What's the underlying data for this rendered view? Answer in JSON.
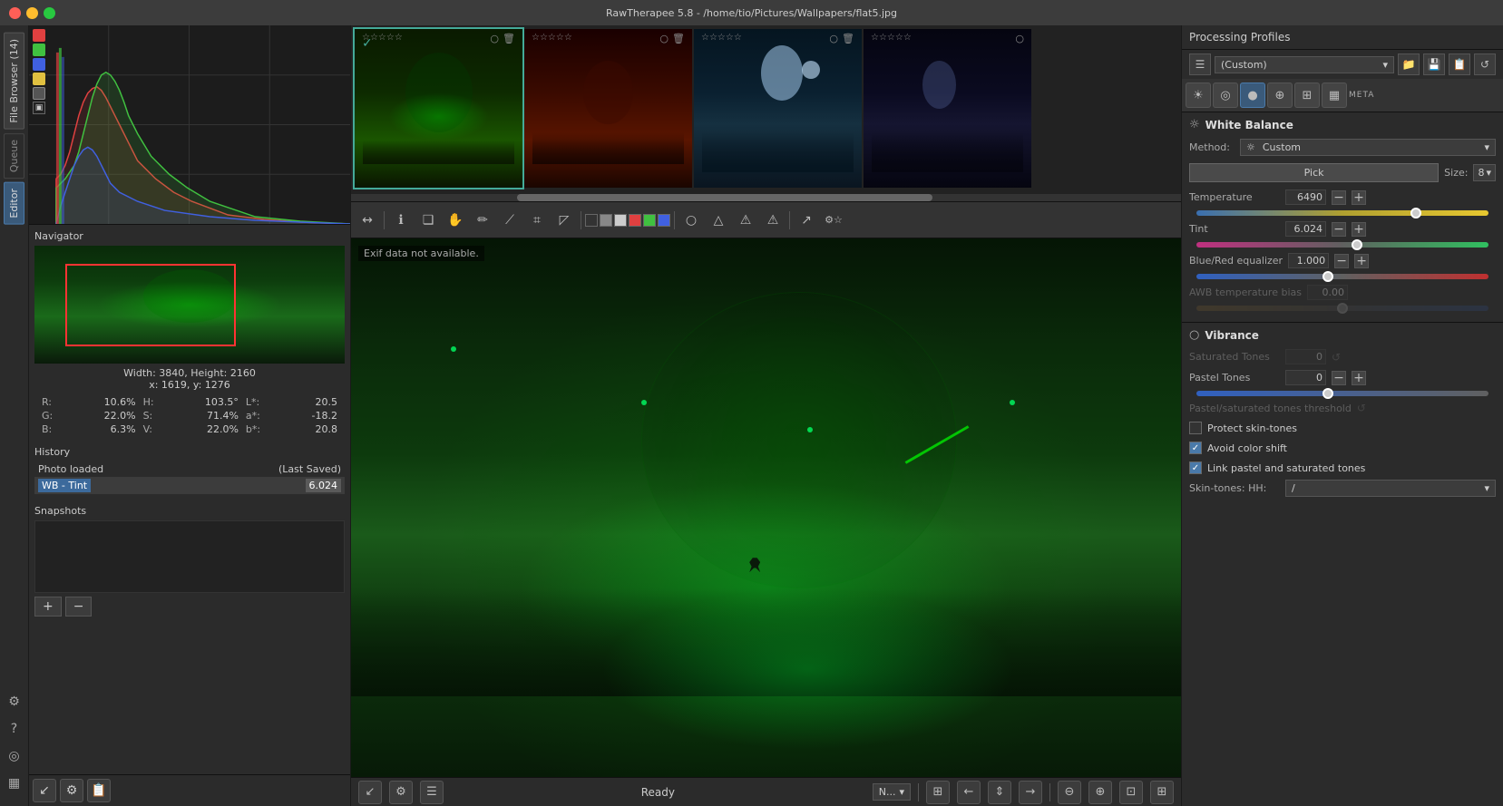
{
  "titlebar": {
    "title": "RawTherapee 5.8 - /home/tio/Pictures/Wallpapers/flat5.jpg"
  },
  "left_sidebar": {
    "tabs": [
      {
        "name": "file-browser",
        "label": "File Browser (14)",
        "active": false
      },
      {
        "name": "queue",
        "label": "Queue",
        "active": false
      },
      {
        "name": "editor",
        "label": "Editor",
        "active": true
      }
    ],
    "bottom_icons": [
      "settings",
      "help",
      "info",
      "chart"
    ]
  },
  "navigator": {
    "title": "Navigator",
    "dimensions": "Width: 3840, Height: 2160",
    "coords": "x: 1619, y: 1276",
    "color_info": {
      "R_label": "R:",
      "R_val": "10.6%",
      "H_label": "H:",
      "H_val": "103.5°",
      "L_label": "L*:",
      "L_val": "20.5",
      "G_label": "G:",
      "G_val": "22.0%",
      "S_label": "S:",
      "S_val": "71.4%",
      "a_label": "a*:",
      "a_val": "-18.2",
      "B_label": "B:",
      "B_val": "6.3%",
      "V_label": "V:",
      "V_val": "22.0%",
      "b_label": "b*:",
      "b_val": "20.8"
    }
  },
  "history": {
    "title": "History",
    "items": [
      {
        "label": "Photo loaded",
        "value": "(Last Saved)"
      },
      {
        "label": "WB - Tint",
        "value": "6.024"
      }
    ]
  },
  "snapshots": {
    "title": "Snapshots",
    "add_label": "+",
    "remove_label": "−"
  },
  "filmstrip": {
    "items": [
      {
        "selected": true,
        "checked": true
      },
      {
        "selected": false
      },
      {
        "selected": false
      },
      {
        "selected": false
      }
    ]
  },
  "editor_toolbar": {
    "tools": [
      "←→",
      "ℹ",
      "❏",
      "✋",
      "✏",
      "⟋",
      "⌗",
      "◸",
      "◻",
      "■",
      "▪",
      "●",
      "○",
      "▲",
      "△",
      "⬆",
      "↗",
      "⟳"
    ]
  },
  "canvas": {
    "exif_message": "Exif data not available."
  },
  "status_bar": {
    "ready": "Ready",
    "nav_mode": "N..."
  },
  "right_panel": {
    "processing_profiles_title": "Processing Profiles",
    "profile_value": "(Custom)",
    "white_balance": {
      "title": "White Balance",
      "method_label": "Method:",
      "method_value": "Custom",
      "pick_label": "Pick",
      "size_label": "Size:",
      "size_value": "8",
      "temperature": {
        "label": "Temperature",
        "value": "6490",
        "thumb_pct": 75
      },
      "tint": {
        "label": "Tint",
        "value": "6.024",
        "thumb_pct": 55
      },
      "blue_red": {
        "label": "Blue/Red equalizer",
        "value": "1.000",
        "thumb_pct": 45
      },
      "awb_bias": {
        "label": "AWB temperature bias",
        "value": "0.00",
        "thumb_pct": 50,
        "disabled": true
      }
    },
    "vibrance": {
      "title": "Vibrance",
      "saturated_tones": {
        "label": "Saturated Tones",
        "value": "0",
        "disabled": true
      },
      "pastel_tones": {
        "label": "Pastel Tones",
        "value": "0",
        "thumb_pct": 45
      },
      "pastel_sat_threshold": {
        "label": "Pastel/saturated tones threshold",
        "disabled": true
      },
      "protect_skin": {
        "label": "Protect skin-tones",
        "checked": false
      },
      "avoid_color_shift": {
        "label": "Avoid color shift",
        "checked": true
      },
      "link_pastel_sat": {
        "label": "Link pastel and saturated tones",
        "checked": true
      },
      "skin_tones": {
        "label": "Skin-tones: HH:",
        "value": "/"
      }
    }
  }
}
